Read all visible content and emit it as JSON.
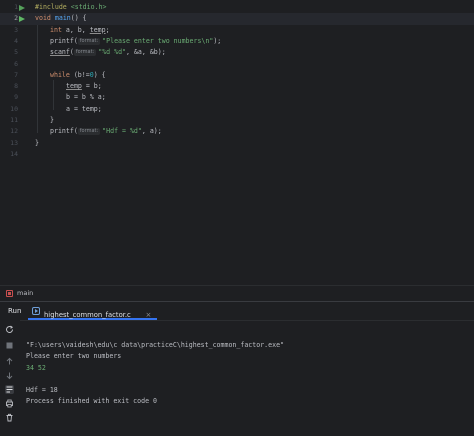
{
  "editor": {
    "current_line": 2,
    "lines": [
      {
        "num": "1"
      },
      {
        "num": "2"
      },
      {
        "num": "3"
      },
      {
        "num": "4"
      },
      {
        "num": "5"
      },
      {
        "num": "6"
      },
      {
        "num": "7"
      },
      {
        "num": "8"
      },
      {
        "num": "9"
      },
      {
        "num": "10"
      },
      {
        "num": "11"
      },
      {
        "num": "12"
      },
      {
        "num": "13"
      },
      {
        "num": "14"
      }
    ],
    "code": {
      "l1_directive": "#include",
      "l1_header": "<stdio.h>",
      "l2_kw": "void",
      "l2_fn": "main",
      "l2_rest": "() {",
      "l3_kw": "int",
      "l3_a": " a, b, ",
      "l3_temp": "temp",
      "l3_end": ";",
      "l4_fn": "printf(",
      "l4_hint": "format:",
      "l4_str": "\"Please enter two numbers\\n\"",
      "l4_end": ");",
      "l5_fn": "scanf",
      "l5_open": "(",
      "l5_hint": "format:",
      "l5_str": "\"%d %d\"",
      "l5_end": ", &a, &b);",
      "l7_kw": "while",
      "l7_open": " (b",
      "l7_op": "!=",
      "l7_num": "0",
      "l7_end": ") {",
      "l8_a": "temp",
      "l8_b": " = b;",
      "l9": "b = b % a;",
      "l10": "a = temp;",
      "l11": "}",
      "l12_fn": "printf(",
      "l12_hint": "format:",
      "l12_str": "\"Hdf = %d\"",
      "l12_end": ", a);",
      "l13": "}"
    }
  },
  "breadcrumb": {
    "label": "main",
    "icon": "function-icon"
  },
  "run_panel": {
    "title": "Run",
    "tab_label": "highest_common_factor.c",
    "tab_close": "×",
    "output": [
      {
        "text": "\"F:\\users\\vaidesh\\edu\\c data\\practiceC\\highest_common_factor.exe\"",
        "kind": "out"
      },
      {
        "text": "Please enter two numbers",
        "kind": "out"
      },
      {
        "text": "34 52",
        "kind": "input"
      },
      {
        "text": "",
        "kind": "out"
      },
      {
        "text": "Hdf = 18",
        "kind": "out"
      },
      {
        "text": "Process finished with exit code 0",
        "kind": "out"
      }
    ]
  },
  "colors": {
    "background": "#1e1f22",
    "keyword": "#cf8e6d",
    "function": "#56a8f5",
    "string": "#6aab73",
    "number": "#2aacb8",
    "run_green": "#5fb865",
    "accent": "#3574f0"
  }
}
